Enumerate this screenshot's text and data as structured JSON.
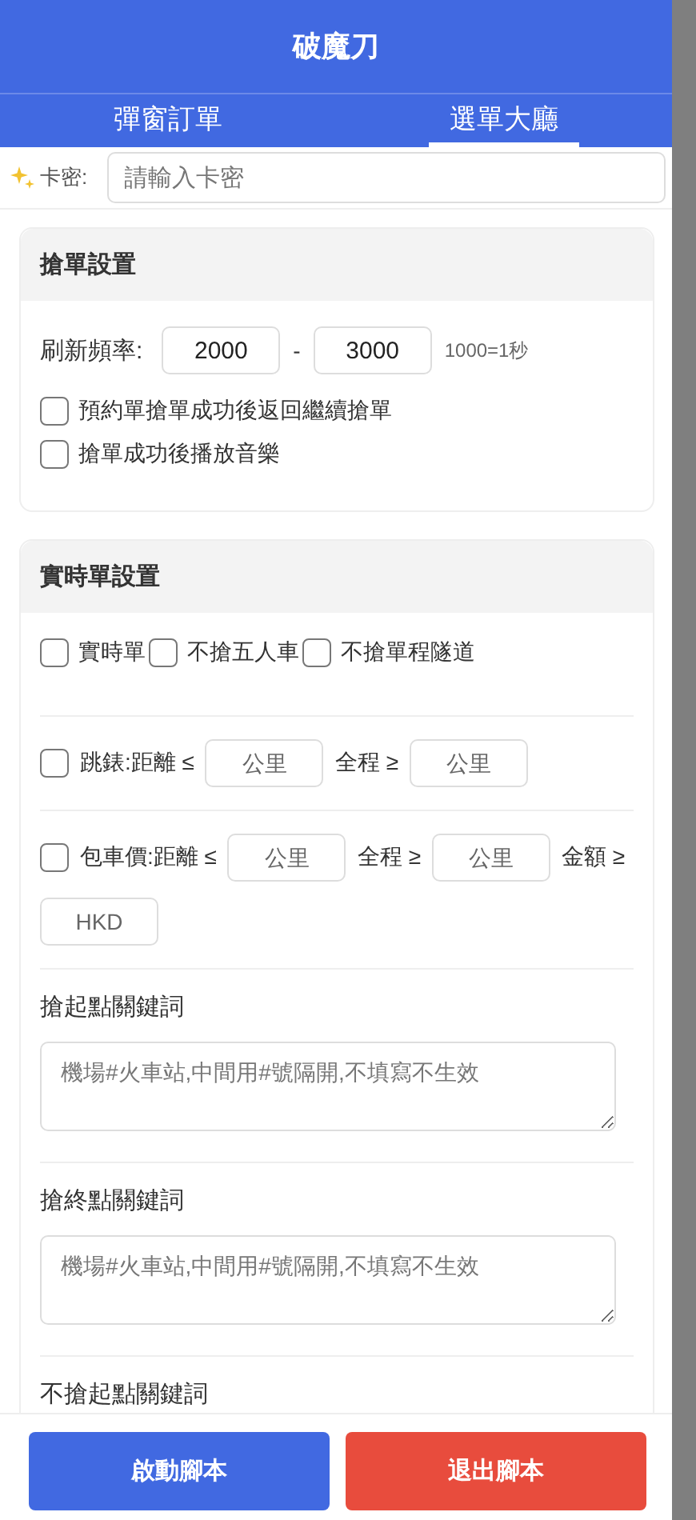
{
  "header": {
    "title": "破魔刀"
  },
  "tabs": [
    {
      "label": "彈窗訂單",
      "selected": false
    },
    {
      "label": "選單大廳",
      "selected": true
    }
  ],
  "card_key": {
    "label": "卡密:",
    "placeholder": "請輸入卡密"
  },
  "grab_settings": {
    "title": "搶單設置",
    "refresh_label": "刷新頻率:",
    "from_value": "2000",
    "separator": "-",
    "to_value": "3000",
    "hint": "1000=1秒",
    "options": [
      {
        "label": "預約單搶單成功後返回繼續搶單",
        "checked": false
      },
      {
        "label": "搶單成功後播放音樂",
        "checked": false
      }
    ]
  },
  "realtime_settings": {
    "title": "實時單設置",
    "rows": [
      {
        "kind": "checks",
        "items": [
          {
            "label": "實時單",
            "checked": false
          },
          {
            "label": "不搶五人車",
            "checked": false
          },
          {
            "label": "不搶單程隧道",
            "checked": false
          }
        ]
      },
      {
        "kind": "filter",
        "checked": false,
        "parts": [
          {
            "kind": "text",
            "text": "跳錶:距離 ≤"
          },
          {
            "kind": "field",
            "placeholder": "公里"
          },
          {
            "kind": "text",
            "text": "全程 ≥"
          },
          {
            "kind": "field",
            "placeholder": "公里"
          }
        ]
      },
      {
        "kind": "filter",
        "checked": false,
        "parts": [
          {
            "kind": "text",
            "text": "包車價:距離 ≤"
          },
          {
            "kind": "field",
            "placeholder": "公里"
          },
          {
            "kind": "text",
            "text": "全程 ≥"
          },
          {
            "kind": "field",
            "placeholder": "公里"
          },
          {
            "kind": "text",
            "text": "金額 ≥"
          },
          {
            "kind": "field",
            "placeholder": "HKD"
          }
        ]
      },
      {
        "kind": "keyword",
        "label": "搶起點關鍵詞",
        "placeholder": "機場#火車站,中間用#號隔開,不填寫不生效"
      },
      {
        "kind": "keyword",
        "label": "搶終點關鍵詞",
        "placeholder": "機場#火車站,中間用#號隔開,不填寫不生效"
      },
      {
        "kind": "heading",
        "label": "不搶起點關鍵詞"
      }
    ]
  },
  "buttons": [
    {
      "label": "啟動腳本",
      "kind": "start"
    },
    {
      "label": "退出腳本",
      "kind": "exit"
    }
  ]
}
